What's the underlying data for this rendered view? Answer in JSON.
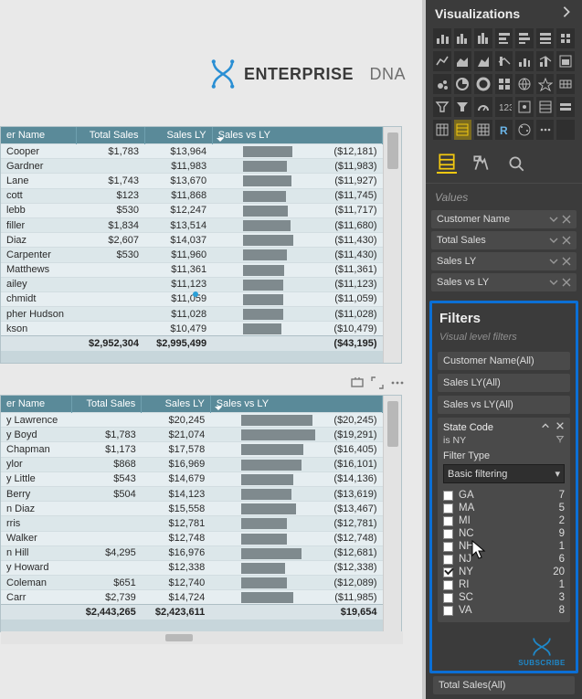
{
  "brand": {
    "bold": "ENTERPRISE",
    "light": "DNA"
  },
  "columns": [
    "er Name",
    "Total Sales",
    "Sales LY",
    "Sales vs LY"
  ],
  "table1": {
    "rows": [
      {
        "name": "Cooper",
        "total": "$1,783",
        "ly": "$13,964",
        "bar": 54,
        "vs": "($12,181)"
      },
      {
        "name": "Gardner",
        "total": "",
        "ly": "$11,983",
        "bar": 48,
        "vs": "($11,983)"
      },
      {
        "name": "Lane",
        "total": "$1,743",
        "ly": "$13,670",
        "bar": 53,
        "vs": "($11,927)"
      },
      {
        "name": "cott",
        "total": "$123",
        "ly": "$11,868",
        "bar": 47,
        "vs": "($11,745)"
      },
      {
        "name": "lebb",
        "total": "$530",
        "ly": "$12,247",
        "bar": 49,
        "vs": "($11,717)"
      },
      {
        "name": "filler",
        "total": "$1,834",
        "ly": "$13,514",
        "bar": 52,
        "vs": "($11,680)"
      },
      {
        "name": "Diaz",
        "total": "$2,607",
        "ly": "$14,037",
        "bar": 55,
        "vs": "($11,430)"
      },
      {
        "name": "Carpenter",
        "total": "$530",
        "ly": "$11,960",
        "bar": 48,
        "vs": "($11,430)"
      },
      {
        "name": "Matthews",
        "total": "",
        "ly": "$11,361",
        "bar": 45,
        "vs": "($11,361)"
      },
      {
        "name": "ailey",
        "total": "",
        "ly": "$11,123",
        "bar": 44,
        "vs": "($11,123)"
      },
      {
        "name": "chmidt",
        "total": "",
        "ly": "$11,059",
        "bar": 44,
        "vs": "($11,059)"
      },
      {
        "name": "pher Hudson",
        "total": "",
        "ly": "$11,028",
        "bar": 44,
        "vs": "($11,028)"
      },
      {
        "name": "kson",
        "total": "",
        "ly": "$10,479",
        "bar": 42,
        "vs": "($10,479)"
      }
    ],
    "totals": {
      "total": "$2,952,304",
      "ly": "$2,995,499",
      "vs": "($43,195)"
    }
  },
  "table2": {
    "rows": [
      {
        "name": "y Lawrence",
        "total": "",
        "ly": "$20,245",
        "bar": 78,
        "vs": "($20,245)"
      },
      {
        "name": "y Boyd",
        "total": "$1,783",
        "ly": "$21,074",
        "bar": 81,
        "vs": "($19,291)"
      },
      {
        "name": "Chapman",
        "total": "$1,173",
        "ly": "$17,578",
        "bar": 68,
        "vs": "($16,405)"
      },
      {
        "name": "ylor",
        "total": "$868",
        "ly": "$16,969",
        "bar": 66,
        "vs": "($16,101)"
      },
      {
        "name": "y Little",
        "total": "$543",
        "ly": "$14,679",
        "bar": 57,
        "vs": "($14,136)"
      },
      {
        "name": "Berry",
        "total": "$504",
        "ly": "$14,123",
        "bar": 55,
        "vs": "($13,619)"
      },
      {
        "name": "n Diaz",
        "total": "",
        "ly": "$15,558",
        "bar": 60,
        "vs": "($13,467)"
      },
      {
        "name": "rris",
        "total": "",
        "ly": "$12,781",
        "bar": 50,
        "vs": "($12,781)"
      },
      {
        "name": "Walker",
        "total": "",
        "ly": "$12,748",
        "bar": 50,
        "vs": "($12,748)"
      },
      {
        "name": "n Hill",
        "total": "$4,295",
        "ly": "$16,976",
        "bar": 66,
        "vs": "($12,681)"
      },
      {
        "name": "y Howard",
        "total": "",
        "ly": "$12,338",
        "bar": 48,
        "vs": "($12,338)"
      },
      {
        "name": "Coleman",
        "total": "$651",
        "ly": "$12,740",
        "bar": 50,
        "vs": "($12,089)"
      },
      {
        "name": "Carr",
        "total": "$2,739",
        "ly": "$14,724",
        "bar": 57,
        "vs": "($11,985)"
      }
    ],
    "totals": {
      "total": "$2,443,265",
      "ly": "$2,423,611",
      "vs": "$19,654"
    }
  },
  "viz": {
    "header": "Visualizations",
    "values_label": "Values",
    "value_pills": [
      "Customer Name",
      "Total Sales",
      "Sales LY",
      "Sales vs LY"
    ]
  },
  "filters": {
    "title": "Filters",
    "sub": "Visual level filters",
    "pills": [
      "Customer Name(All)",
      "Sales LY(All)",
      "Sales vs LY(All)"
    ],
    "state": {
      "title": "State Code",
      "note": "is NY",
      "ftype_label": "Filter Type",
      "ftype_value": "Basic filtering",
      "rows": [
        {
          "code": "GA",
          "n": "7",
          "c": false
        },
        {
          "code": "MA",
          "n": "5",
          "c": false
        },
        {
          "code": "MI",
          "n": "2",
          "c": false
        },
        {
          "code": "NC",
          "n": "9",
          "c": false
        },
        {
          "code": "NH",
          "n": "1",
          "c": false
        },
        {
          "code": "NJ",
          "n": "6",
          "c": false
        },
        {
          "code": "NY",
          "n": "20",
          "c": true
        },
        {
          "code": "RI",
          "n": "1",
          "c": false
        },
        {
          "code": "SC",
          "n": "3",
          "c": false
        },
        {
          "code": "VA",
          "n": "8",
          "c": false
        }
      ]
    },
    "bottom_pill": "Total Sales(All)"
  },
  "subscribe": "SUBSCRIBE"
}
